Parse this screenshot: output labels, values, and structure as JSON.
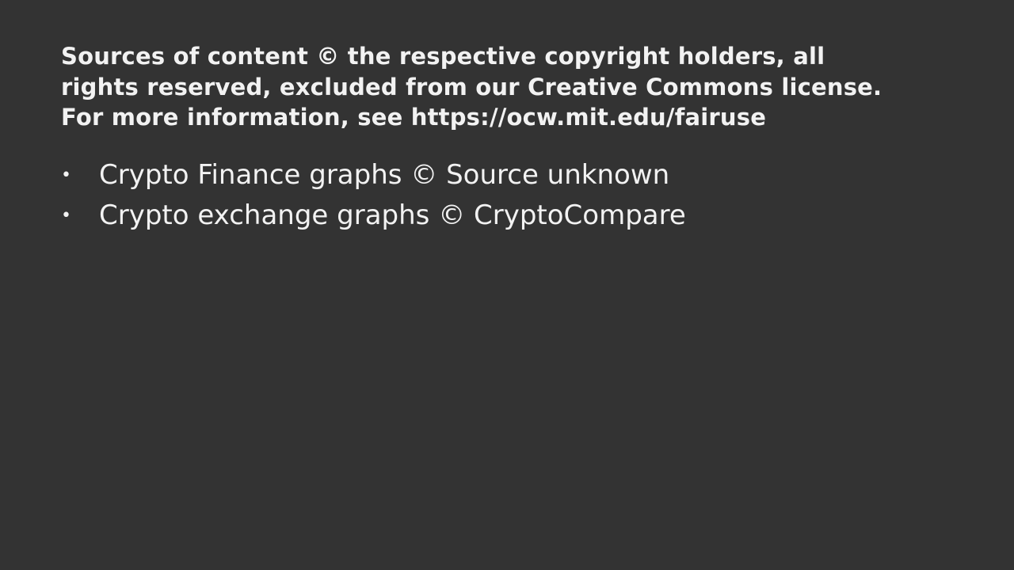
{
  "notice": {
    "lines": [
      "Sources of content © the respective copyright holders, all",
      "rights reserved, excluded from our Creative Commons license.",
      "For more information, see https://ocw.mit.edu/fairuse"
    ]
  },
  "credits": {
    "bullet": "•",
    "items": [
      "Crypto Finance graphs © Source unknown",
      "Crypto exchange graphs © CryptoCompare"
    ]
  },
  "colors": {
    "background": "#333333",
    "text": "#f2f2f2"
  }
}
